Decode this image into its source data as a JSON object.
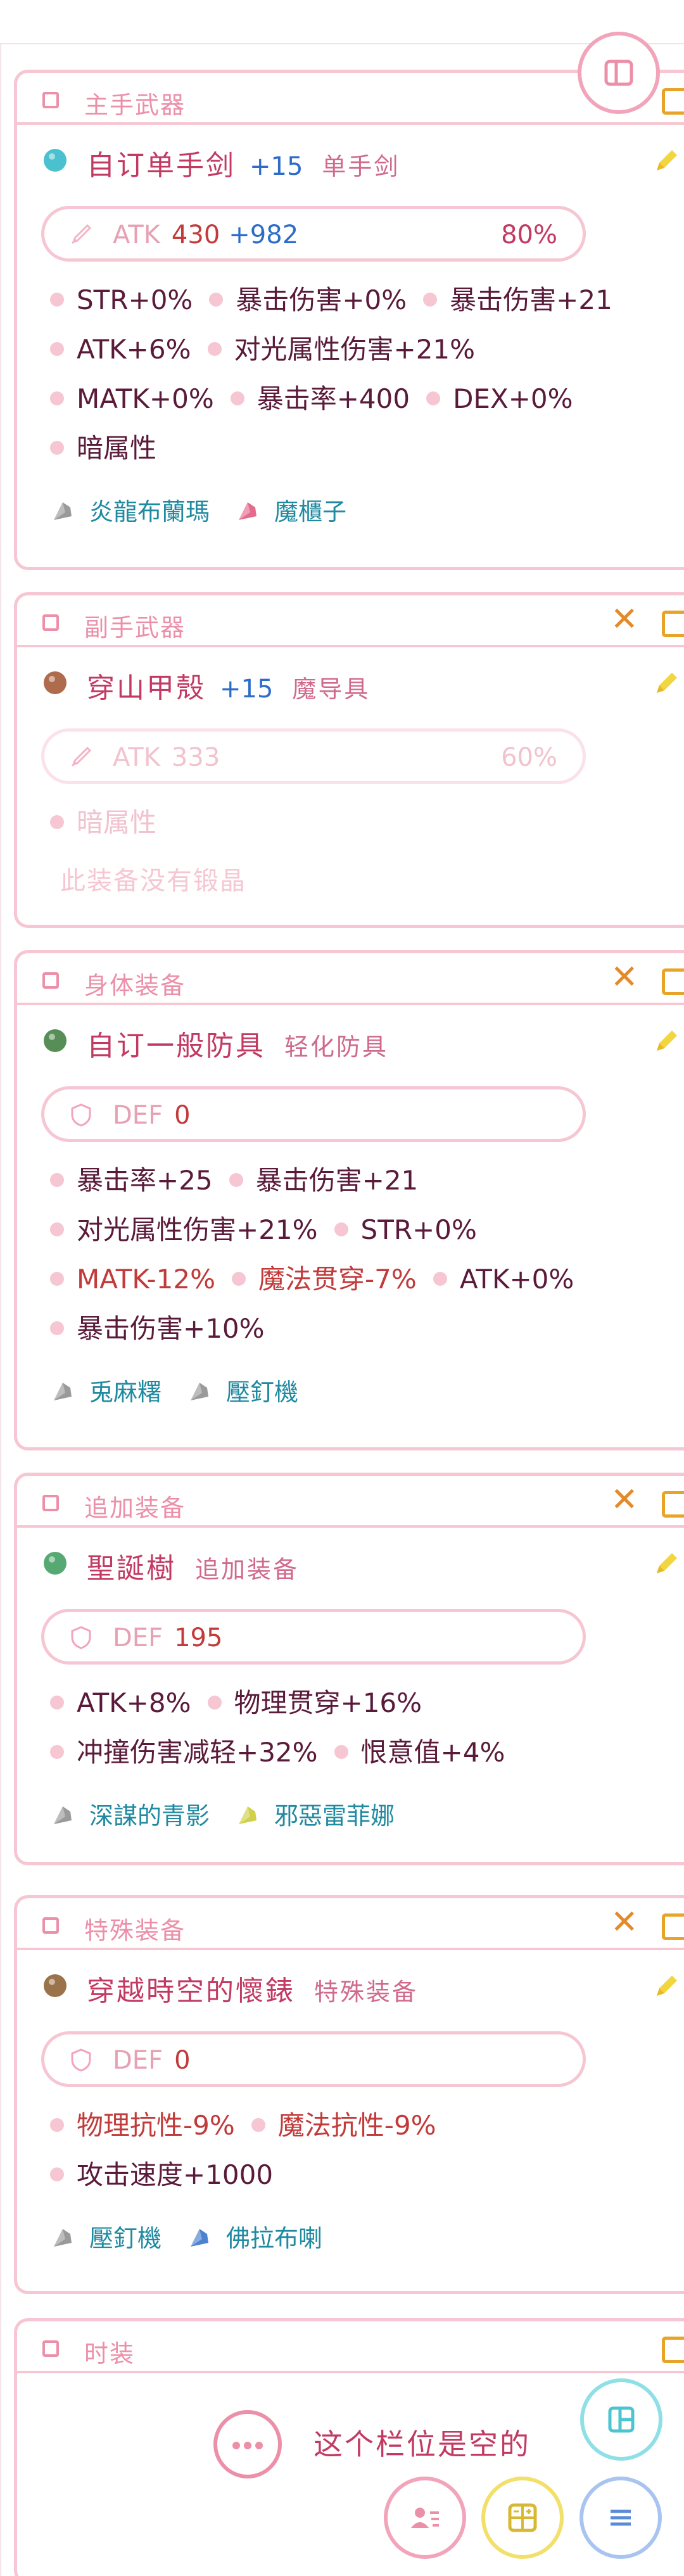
{
  "slots": [
    {
      "title": "主手武器",
      "has_remove": false,
      "item": {
        "name": "自订单手剑",
        "refine": "+15",
        "type": "单手剑",
        "icon": "sword-icon",
        "icon_color": "#2bb6c8"
      },
      "stat": {
        "label": "ATK",
        "value": "430",
        "bonus": "+982",
        "percent": "80%",
        "icon": "sword-outline-icon"
      },
      "attrs": [
        [
          {
            "text": "STR+0%"
          },
          {
            "text": "暴击伤害+0%"
          },
          {
            "text": "暴击伤害+21"
          }
        ],
        [
          {
            "text": "ATK+6%"
          },
          {
            "text": "对光属性伤害+21%"
          }
        ],
        [
          {
            "text": "MATK+0%"
          },
          {
            "text": "暴击率+400"
          },
          {
            "text": "DEX+0%"
          }
        ],
        [
          {
            "text": "暗属性"
          }
        ]
      ],
      "crystals": [
        {
          "name": "炎龍布蘭瑪",
          "color": "#888888"
        },
        {
          "name": "魔櫃子",
          "color": "#e0507a"
        }
      ]
    },
    {
      "title": "副手武器",
      "has_remove": true,
      "item": {
        "name": "穿山甲殼",
        "refine": "+15",
        "type": "魔导具",
        "icon": "shell-icon",
        "icon_color": "#a0522d"
      },
      "stat": {
        "label": "ATK",
        "value": "333",
        "bonus": "",
        "percent": "60%",
        "icon": "sword-outline-icon",
        "faded": true
      },
      "attrs": [
        [
          {
            "text": "暗属性",
            "faded": true
          }
        ]
      ],
      "empty_crystals": "此装备没有锻晶",
      "crystals": []
    },
    {
      "title": "身体装备",
      "has_remove": true,
      "item": {
        "name": "自订一般防具",
        "refine": "",
        "type": "轻化防具",
        "icon": "armor-icon",
        "icon_color": "#3a7a3a"
      },
      "stat": {
        "label": "DEF",
        "value": "0",
        "bonus": "",
        "percent": "",
        "icon": "shield-icon"
      },
      "attrs": [
        [
          {
            "text": "暴击率+25"
          },
          {
            "text": "暴击伤害+21"
          }
        ],
        [
          {
            "text": "对光属性伤害+21%"
          },
          {
            "text": "STR+0%"
          }
        ],
        [
          {
            "text": "MATK-12%",
            "red": true
          },
          {
            "text": "魔法贯穿-7%",
            "red": true
          },
          {
            "text": "ATK+0%"
          }
        ],
        [
          {
            "text": "暴击伤害+10%"
          }
        ]
      ],
      "crystals": [
        {
          "name": "兎麻糬",
          "color": "#888888"
        },
        {
          "name": "壓釘機",
          "color": "#888888"
        }
      ]
    },
    {
      "title": "追加装备",
      "has_remove": true,
      "item": {
        "name": "聖誕樹",
        "refine": "",
        "type": "追加装备",
        "icon": "tree-icon",
        "icon_color": "#3a9a5a"
      },
      "stat": {
        "label": "DEF",
        "value": "195",
        "bonus": "",
        "percent": "",
        "icon": "shield-icon"
      },
      "attrs": [
        [
          {
            "text": "ATK+8%"
          },
          {
            "text": "物理贯穿+16%"
          }
        ],
        [
          {
            "text": "冲撞伤害减轻+32%"
          },
          {
            "text": "恨意值+4%"
          }
        ]
      ],
      "crystals": [
        {
          "name": "深謀的青影",
          "color": "#888888"
        },
        {
          "name": "邪惡雷菲娜",
          "color": "#c8c82a"
        }
      ]
    },
    {
      "title": "特殊装备",
      "has_remove": true,
      "item": {
        "name": "穿越時空的懷錶",
        "refine": "",
        "type": "特殊装备",
        "icon": "pocket-watch-icon",
        "icon_color": "#8a5a2a"
      },
      "stat": {
        "label": "DEF",
        "value": "0",
        "bonus": "",
        "percent": "",
        "icon": "shield-icon"
      },
      "attrs": [
        [
          {
            "text": "物理抗性-9%",
            "red": true
          },
          {
            "text": "魔法抗性-9%",
            "red": true
          }
        ],
        [
          {
            "text": "攻击速度+1000"
          }
        ]
      ],
      "crystals": [
        {
          "name": "壓釘機",
          "color": "#888888"
        },
        {
          "name": "佛拉布喇",
          "color": "#2d6cc8"
        }
      ]
    }
  ],
  "fashion": {
    "title": "时装",
    "empty_text": "这个栏位是空的"
  },
  "fabs": {
    "top": {
      "icon": "sidebar-panel-icon",
      "color": "#f2a4bb"
    },
    "layout": {
      "icon": "layout-panel-icon",
      "color": "#8fe0e6"
    },
    "profile": {
      "icon": "profile-list-icon",
      "color": "#f2a4bb"
    },
    "calculator": {
      "icon": "calculator-icon",
      "color": "#f2e06a"
    },
    "menu": {
      "icon": "menu-icon",
      "color": "#a9c4f0"
    }
  }
}
